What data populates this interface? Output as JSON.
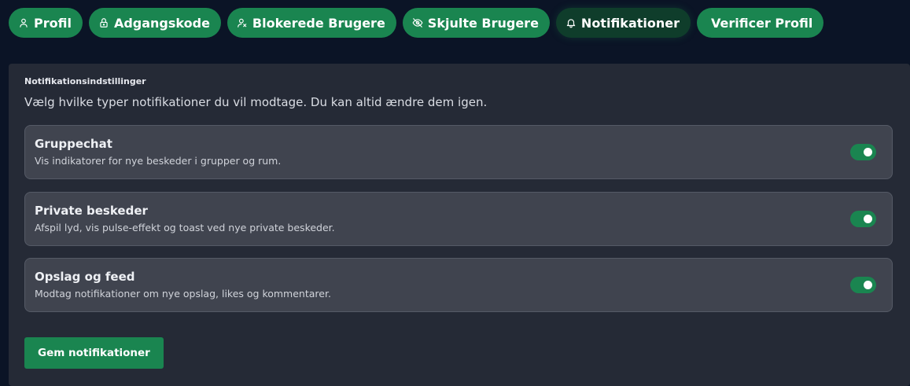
{
  "tabs": [
    {
      "label": "Profil",
      "icon": "user-icon",
      "active": false
    },
    {
      "label": "Adgangskode",
      "icon": "lock-icon",
      "active": false
    },
    {
      "label": "Blokerede Brugere",
      "icon": "user-x-icon",
      "active": false
    },
    {
      "label": "Skjulte Brugere",
      "icon": "eye-off-icon",
      "active": false
    },
    {
      "label": "Notifikationer",
      "icon": "bell-icon",
      "active": true
    },
    {
      "label": "Verificer Profil",
      "icon": "",
      "active": false
    }
  ],
  "panel": {
    "title": "Notifikationsindstillinger",
    "description": "Vælg hvilke typer notifikationer du vil modtage. Du kan altid ændre dem igen."
  },
  "settings": [
    {
      "title": "Gruppechat",
      "description": "Vis indikatorer for nye beskeder i grupper og rum.",
      "enabled": true
    },
    {
      "title": "Private beskeder",
      "description": "Afspil lyd, vis pulse-effekt og toast ved nye private beskeder.",
      "enabled": true
    },
    {
      "title": "Opslag og feed",
      "description": "Modtag notifikationer om nye opslag, likes og kommentarer.",
      "enabled": true
    }
  ],
  "save_label": "Gem notifikationer",
  "colors": {
    "accent": "#1a8550",
    "accent_active": "#0f3d2b",
    "background": "#0b1426",
    "panel": "#252a36",
    "card": "#40444f"
  }
}
